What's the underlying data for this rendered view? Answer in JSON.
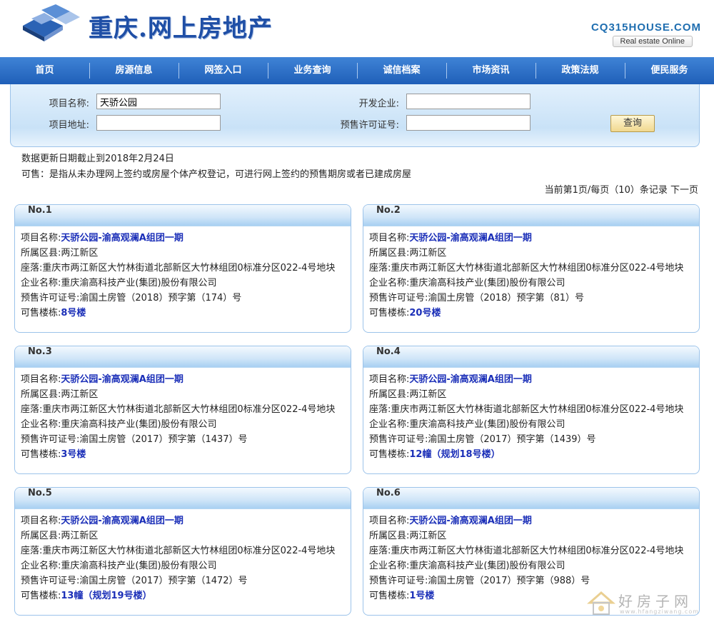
{
  "header": {
    "site_title": "重庆.网上房地产",
    "domain": "CQ315HOUSE.COM",
    "tagline": "Real estate Online"
  },
  "nav": {
    "items": [
      "首页",
      "房源信息",
      "网签入口",
      "业务查询",
      "诚信档案",
      "市场资讯",
      "政策法规",
      "便民服务"
    ]
  },
  "search": {
    "project_name_label": "项目名称:",
    "project_name_value": "天骄公园",
    "project_address_label": "项目地址:",
    "project_address_value": "",
    "developer_label": "开发企业:",
    "developer_value": "",
    "presale_label": "预售许可证号:",
    "presale_value": "",
    "query_button": "查询"
  },
  "info": {
    "update_date": "数据更新日期截止到2018年2月24日",
    "available_note": "可售：是指从未办理网上签约或房屋个体产权登记，可进行网上签约的预售期房或者已建成房屋",
    "pager_text": "当前第1页/每页（10）条记录",
    "next_page": "下一页"
  },
  "labels": {
    "project": "项目名称:",
    "district": "所属区县:",
    "location": "座落:",
    "company": "企业名称:",
    "presale": "预售许可证号:",
    "buildings": "可售楼栋:"
  },
  "cards": [
    {
      "no": "No.1",
      "project": "天骄公园-渝高观澜A组团一期",
      "district": "两江新区",
      "location": "重庆市两江新区大竹林街道北部新区大竹林组团0标准分区022-4号地块",
      "company": "重庆渝高科技产业(集团)股份有限公司",
      "presale": "渝国土房管（2018）预字第（174）号",
      "buildings": "8号楼"
    },
    {
      "no": "No.2",
      "project": "天骄公园-渝高观澜A组团一期",
      "district": "两江新区",
      "location": "重庆市两江新区大竹林街道北部新区大竹林组团0标准分区022-4号地块",
      "company": "重庆渝高科技产业(集团)股份有限公司",
      "presale": "渝国土房管（2018）预字第（81）号",
      "buildings": "20号楼"
    },
    {
      "no": "No.3",
      "project": "天骄公园-渝高观澜A组团一期",
      "district": "两江新区",
      "location": "重庆市两江新区大竹林街道北部新区大竹林组团0标准分区022-4号地块",
      "company": "重庆渝高科技产业(集团)股份有限公司",
      "presale": "渝国土房管（2017）预字第（1437）号",
      "buildings": "3号楼"
    },
    {
      "no": "No.4",
      "project": "天骄公园-渝高观澜A组团一期",
      "district": "两江新区",
      "location": "重庆市两江新区大竹林街道北部新区大竹林组团0标准分区022-4号地块",
      "company": "重庆渝高科技产业(集团)股份有限公司",
      "presale": "渝国土房管（2017）预字第（1439）号",
      "buildings": "12幢（规划18号楼）"
    },
    {
      "no": "No.5",
      "project": "天骄公园-渝高观澜A组团一期",
      "district": "两江新区",
      "location": "重庆市两江新区大竹林街道北部新区大竹林组团0标准分区022-4号地块",
      "company": "重庆渝高科技产业(集团)股份有限公司",
      "presale": "渝国土房管（2017）预字第（1472）号",
      "buildings": "13幢（规划19号楼）"
    },
    {
      "no": "No.6",
      "project": "天骄公园-渝高观澜A组团一期",
      "district": "两江新区",
      "location": "重庆市两江新区大竹林街道北部新区大竹林组团0标准分区022-4号地块",
      "company": "重庆渝高科技产业(集团)股份有限公司",
      "presale": "渝国土房管（2017）预字第（988）号",
      "buildings": "1号楼"
    }
  ],
  "watermark": {
    "text": "好房子网",
    "url": "www.hfangziwang.com"
  },
  "colors": {
    "nav_bg": "#2a6cc6",
    "link": "#1b2fb8",
    "title": "#1f4fa6"
  }
}
